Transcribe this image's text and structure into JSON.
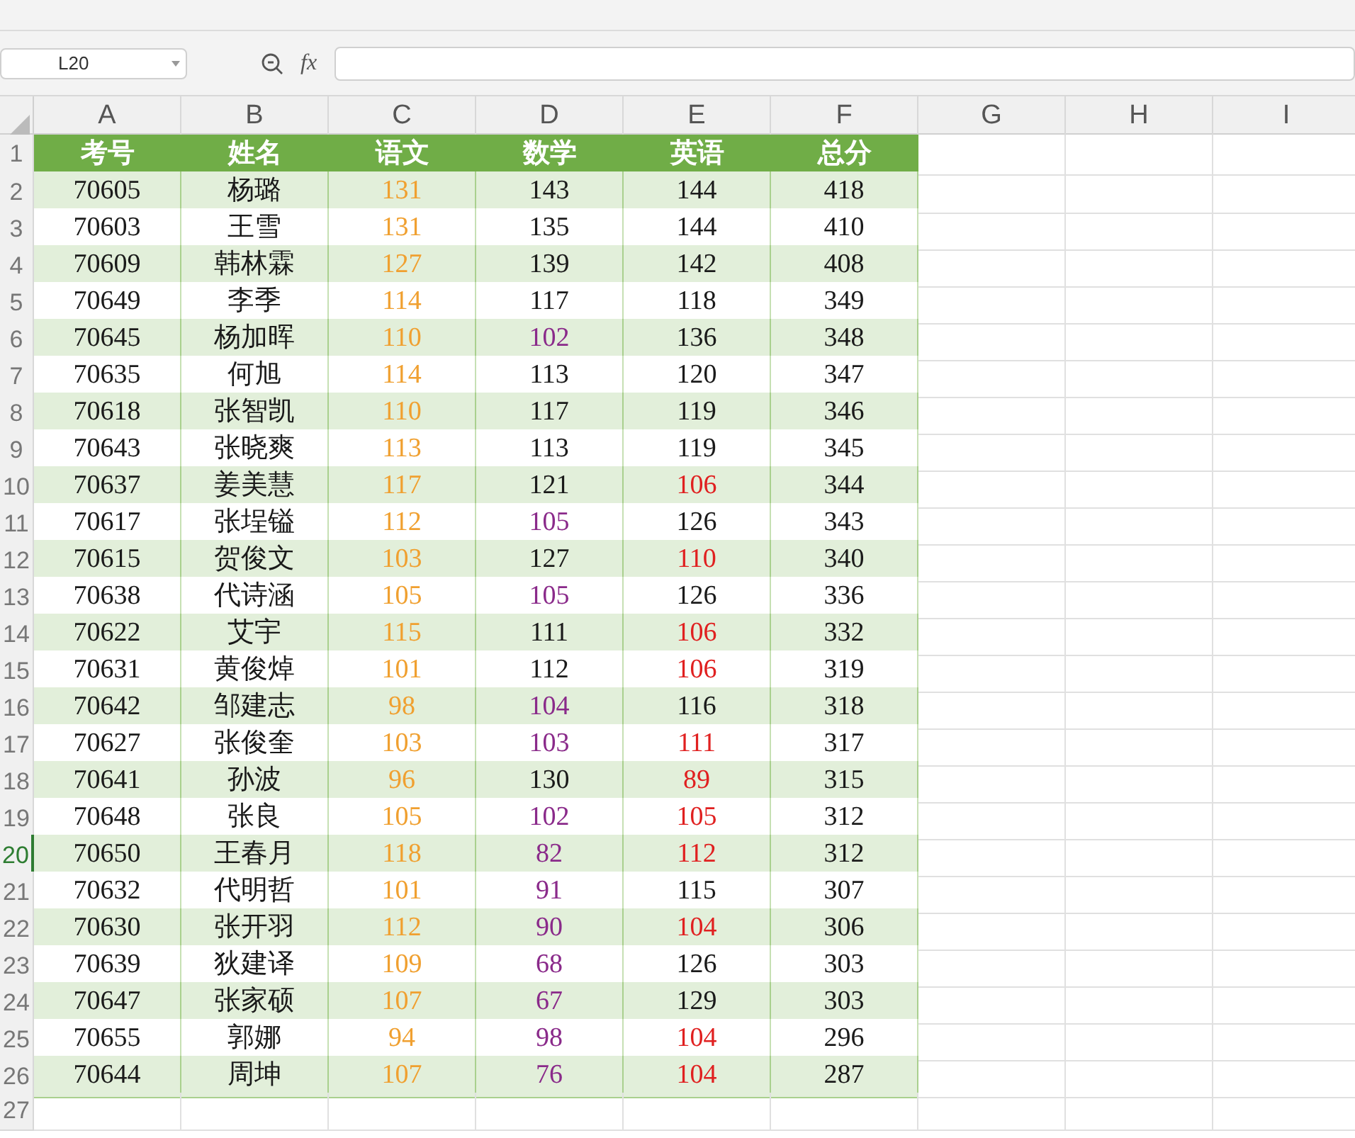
{
  "name_box": {
    "value": "L20"
  },
  "formula_bar": {
    "fx": "fx"
  },
  "columns": [
    {
      "label": "A",
      "selected": false
    },
    {
      "label": "B",
      "selected": false
    },
    {
      "label": "C",
      "selected": false
    },
    {
      "label": "D",
      "selected": false
    },
    {
      "label": "E",
      "selected": false
    },
    {
      "label": "F",
      "selected": false
    },
    {
      "label": "G",
      "selected": false
    },
    {
      "label": "H",
      "selected": false
    },
    {
      "label": "I",
      "selected": false
    }
  ],
  "row_headers": [
    {
      "label": "1",
      "selected": false
    },
    {
      "label": "2",
      "selected": false
    },
    {
      "label": "3",
      "selected": false
    },
    {
      "label": "4",
      "selected": false
    },
    {
      "label": "5",
      "selected": false
    },
    {
      "label": "6",
      "selected": false
    },
    {
      "label": "7",
      "selected": false
    },
    {
      "label": "8",
      "selected": false
    },
    {
      "label": "9",
      "selected": false
    },
    {
      "label": "10",
      "selected": false
    },
    {
      "label": "11",
      "selected": false
    },
    {
      "label": "12",
      "selected": false
    },
    {
      "label": "13",
      "selected": false
    },
    {
      "label": "14",
      "selected": false
    },
    {
      "label": "15",
      "selected": false
    },
    {
      "label": "16",
      "selected": false
    },
    {
      "label": "17",
      "selected": false
    },
    {
      "label": "18",
      "selected": false
    },
    {
      "label": "19",
      "selected": false
    },
    {
      "label": "20",
      "selected": true
    },
    {
      "label": "21",
      "selected": false
    },
    {
      "label": "22",
      "selected": false
    },
    {
      "label": "23",
      "selected": false
    },
    {
      "label": "24",
      "selected": false
    },
    {
      "label": "25",
      "selected": false
    },
    {
      "label": "26",
      "selected": false
    },
    {
      "label": "27",
      "selected": false
    }
  ],
  "table": {
    "headers": [
      "考号",
      "姓名",
      "语文",
      "数学",
      "英语",
      "总分"
    ],
    "rows": [
      [
        {
          "text": "70605"
        },
        {
          "text": "杨璐"
        },
        {
          "text": "131",
          "color": "#f0a030"
        },
        {
          "text": "143"
        },
        {
          "text": "144"
        },
        {
          "text": "418"
        }
      ],
      [
        {
          "text": "70603"
        },
        {
          "text": "王雪"
        },
        {
          "text": "131",
          "color": "#f0a030"
        },
        {
          "text": "135"
        },
        {
          "text": "144"
        },
        {
          "text": "410"
        }
      ],
      [
        {
          "text": "70609"
        },
        {
          "text": "韩林霖"
        },
        {
          "text": "127",
          "color": "#f0a030"
        },
        {
          "text": "139"
        },
        {
          "text": "142"
        },
        {
          "text": "408"
        }
      ],
      [
        {
          "text": "70649"
        },
        {
          "text": "李季"
        },
        {
          "text": "114",
          "color": "#f0a030"
        },
        {
          "text": "117"
        },
        {
          "text": "118"
        },
        {
          "text": "349"
        }
      ],
      [
        {
          "text": "70645"
        },
        {
          "text": "杨加晖"
        },
        {
          "text": "110",
          "color": "#f0a030"
        },
        {
          "text": "102",
          "color": "#8a2a8a"
        },
        {
          "text": "136"
        },
        {
          "text": "348"
        }
      ],
      [
        {
          "text": "70635"
        },
        {
          "text": "何旭"
        },
        {
          "text": "114",
          "color": "#f0a030"
        },
        {
          "text": "113"
        },
        {
          "text": "120"
        },
        {
          "text": "347"
        }
      ],
      [
        {
          "text": "70618"
        },
        {
          "text": "张智凯"
        },
        {
          "text": "110",
          "color": "#f0a030"
        },
        {
          "text": "117"
        },
        {
          "text": "119"
        },
        {
          "text": "346"
        }
      ],
      [
        {
          "text": "70643"
        },
        {
          "text": "张晓爽"
        },
        {
          "text": "113",
          "color": "#f0a030"
        },
        {
          "text": "113"
        },
        {
          "text": "119"
        },
        {
          "text": "345"
        }
      ],
      [
        {
          "text": "70637"
        },
        {
          "text": "姜美慧"
        },
        {
          "text": "117",
          "color": "#f0a030"
        },
        {
          "text": "121"
        },
        {
          "text": "106",
          "color": "#e02020"
        },
        {
          "text": "344"
        }
      ],
      [
        {
          "text": "70617"
        },
        {
          "text": "张埕镒"
        },
        {
          "text": "112",
          "color": "#f0a030"
        },
        {
          "text": "105",
          "color": "#8a2a8a"
        },
        {
          "text": "126"
        },
        {
          "text": "343"
        }
      ],
      [
        {
          "text": "70615"
        },
        {
          "text": "贺俊文"
        },
        {
          "text": "103",
          "color": "#f0a030"
        },
        {
          "text": "127"
        },
        {
          "text": "110",
          "color": "#e02020"
        },
        {
          "text": "340"
        }
      ],
      [
        {
          "text": "70638"
        },
        {
          "text": "代诗涵"
        },
        {
          "text": "105",
          "color": "#f0a030"
        },
        {
          "text": "105",
          "color": "#8a2a8a"
        },
        {
          "text": "126"
        },
        {
          "text": "336"
        }
      ],
      [
        {
          "text": "70622"
        },
        {
          "text": "艾宇"
        },
        {
          "text": "115",
          "color": "#f0a030"
        },
        {
          "text": "111"
        },
        {
          "text": "106",
          "color": "#e02020"
        },
        {
          "text": "332"
        }
      ],
      [
        {
          "text": "70631"
        },
        {
          "text": "黄俊焯"
        },
        {
          "text": "101",
          "color": "#f0a030"
        },
        {
          "text": "112"
        },
        {
          "text": "106",
          "color": "#e02020"
        },
        {
          "text": "319"
        }
      ],
      [
        {
          "text": "70642"
        },
        {
          "text": "邹建志"
        },
        {
          "text": "98",
          "color": "#f0a030"
        },
        {
          "text": "104",
          "color": "#8a2a8a"
        },
        {
          "text": "116"
        },
        {
          "text": "318"
        }
      ],
      [
        {
          "text": "70627"
        },
        {
          "text": "张俊奎"
        },
        {
          "text": "103",
          "color": "#f0a030"
        },
        {
          "text": "103",
          "color": "#8a2a8a"
        },
        {
          "text": "111",
          "color": "#e02020"
        },
        {
          "text": "317"
        }
      ],
      [
        {
          "text": "70641"
        },
        {
          "text": "孙波"
        },
        {
          "text": "96",
          "color": "#f0a030"
        },
        {
          "text": "130"
        },
        {
          "text": "89",
          "color": "#e02020"
        },
        {
          "text": "315"
        }
      ],
      [
        {
          "text": "70648"
        },
        {
          "text": "张良"
        },
        {
          "text": "105",
          "color": "#f0a030"
        },
        {
          "text": "102",
          "color": "#8a2a8a"
        },
        {
          "text": "105",
          "color": "#e02020"
        },
        {
          "text": "312"
        }
      ],
      [
        {
          "text": "70650"
        },
        {
          "text": "王春月"
        },
        {
          "text": "118",
          "color": "#f0a030"
        },
        {
          "text": "82",
          "color": "#8a2a8a"
        },
        {
          "text": "112",
          "color": "#e02020"
        },
        {
          "text": "312"
        }
      ],
      [
        {
          "text": "70632"
        },
        {
          "text": "代明哲"
        },
        {
          "text": "101",
          "color": "#f0a030"
        },
        {
          "text": "91",
          "color": "#8a2a8a"
        },
        {
          "text": "115"
        },
        {
          "text": "307"
        }
      ],
      [
        {
          "text": "70630"
        },
        {
          "text": "张开羽"
        },
        {
          "text": "112",
          "color": "#f0a030"
        },
        {
          "text": "90",
          "color": "#8a2a8a"
        },
        {
          "text": "104",
          "color": "#e02020"
        },
        {
          "text": "306"
        }
      ],
      [
        {
          "text": "70639"
        },
        {
          "text": "狄建译"
        },
        {
          "text": "109",
          "color": "#f0a030"
        },
        {
          "text": "68",
          "color": "#8a2a8a"
        },
        {
          "text": "126"
        },
        {
          "text": "303"
        }
      ],
      [
        {
          "text": "70647"
        },
        {
          "text": "张家硕"
        },
        {
          "text": "107",
          "color": "#f0a030"
        },
        {
          "text": "67",
          "color": "#8a2a8a"
        },
        {
          "text": "129"
        },
        {
          "text": "303"
        }
      ],
      [
        {
          "text": "70655"
        },
        {
          "text": "郭娜"
        },
        {
          "text": "94",
          "color": "#f0a030"
        },
        {
          "text": "98",
          "color": "#8a2a8a"
        },
        {
          "text": "104",
          "color": "#e02020"
        },
        {
          "text": "296"
        }
      ],
      [
        {
          "text": "70644"
        },
        {
          "text": "周坤"
        },
        {
          "text": "107",
          "color": "#f0a030"
        },
        {
          "text": "76",
          "color": "#8a2a8a"
        },
        {
          "text": "104",
          "color": "#e02020"
        },
        {
          "text": "287"
        }
      ]
    ]
  }
}
